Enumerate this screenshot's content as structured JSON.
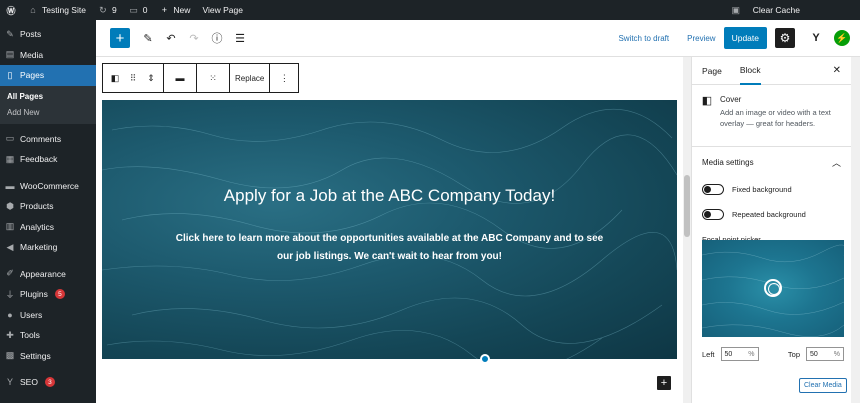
{
  "adminbar": {
    "site_name": "Testing Site",
    "updates_count": "9",
    "comments_count": "0",
    "new_label": "New",
    "view_page": "View Page",
    "clear_cache": "Clear Cache"
  },
  "sidebar": {
    "items": [
      {
        "label": "Posts",
        "icon": "pin-icon"
      },
      {
        "label": "Media",
        "icon": "media-icon"
      },
      {
        "label": "Pages",
        "icon": "pages-icon"
      }
    ],
    "sub_items": [
      "All Pages",
      "Add New"
    ],
    "items2": [
      {
        "label": "Comments",
        "icon": "comment-icon"
      },
      {
        "label": "Feedback",
        "icon": "feedback-icon"
      },
      {
        "label": "WooCommerce",
        "icon": "woo-icon"
      },
      {
        "label": "Products",
        "icon": "products-icon"
      },
      {
        "label": "Analytics",
        "icon": "analytics-icon"
      },
      {
        "label": "Marketing",
        "icon": "megaphone-icon"
      },
      {
        "label": "Appearance",
        "icon": "brush-icon"
      },
      {
        "label": "Plugins",
        "icon": "plug-icon",
        "badge": "5"
      },
      {
        "label": "Users",
        "icon": "users-icon"
      },
      {
        "label": "Tools",
        "icon": "wrench-icon"
      },
      {
        "label": "Settings",
        "icon": "settings-icon"
      },
      {
        "label": "SEO",
        "icon": "yoast-icon",
        "badge": "3"
      }
    ]
  },
  "toolbar": {
    "switch_draft": "Switch to draft",
    "preview": "Preview",
    "update": "Update"
  },
  "block_toolbar": {
    "replace": "Replace"
  },
  "cover": {
    "title": "Apply for a Job at the ABC Company Today!",
    "text": "Click here to learn more about the opportunities available at the ABC Company and to see our job listings. We can't wait to hear from you!"
  },
  "panel": {
    "tab_page": "Page",
    "tab_block": "Block",
    "block_name": "Cover",
    "block_desc": "Add an image or video with a text overlay — great for headers.",
    "media_settings": "Media settings",
    "fixed_background": "Fixed background",
    "repeated_background": "Repeated background",
    "focal_point_picker": "Focal point picker",
    "left_label": "Left",
    "left_value": "50",
    "top_label": "Top",
    "top_value": "50",
    "percent": "%",
    "clear_media": "Clear Media"
  },
  "colors": {
    "accent": "#007cba",
    "admin_dark": "#1d2327",
    "badge": "#d63638"
  }
}
